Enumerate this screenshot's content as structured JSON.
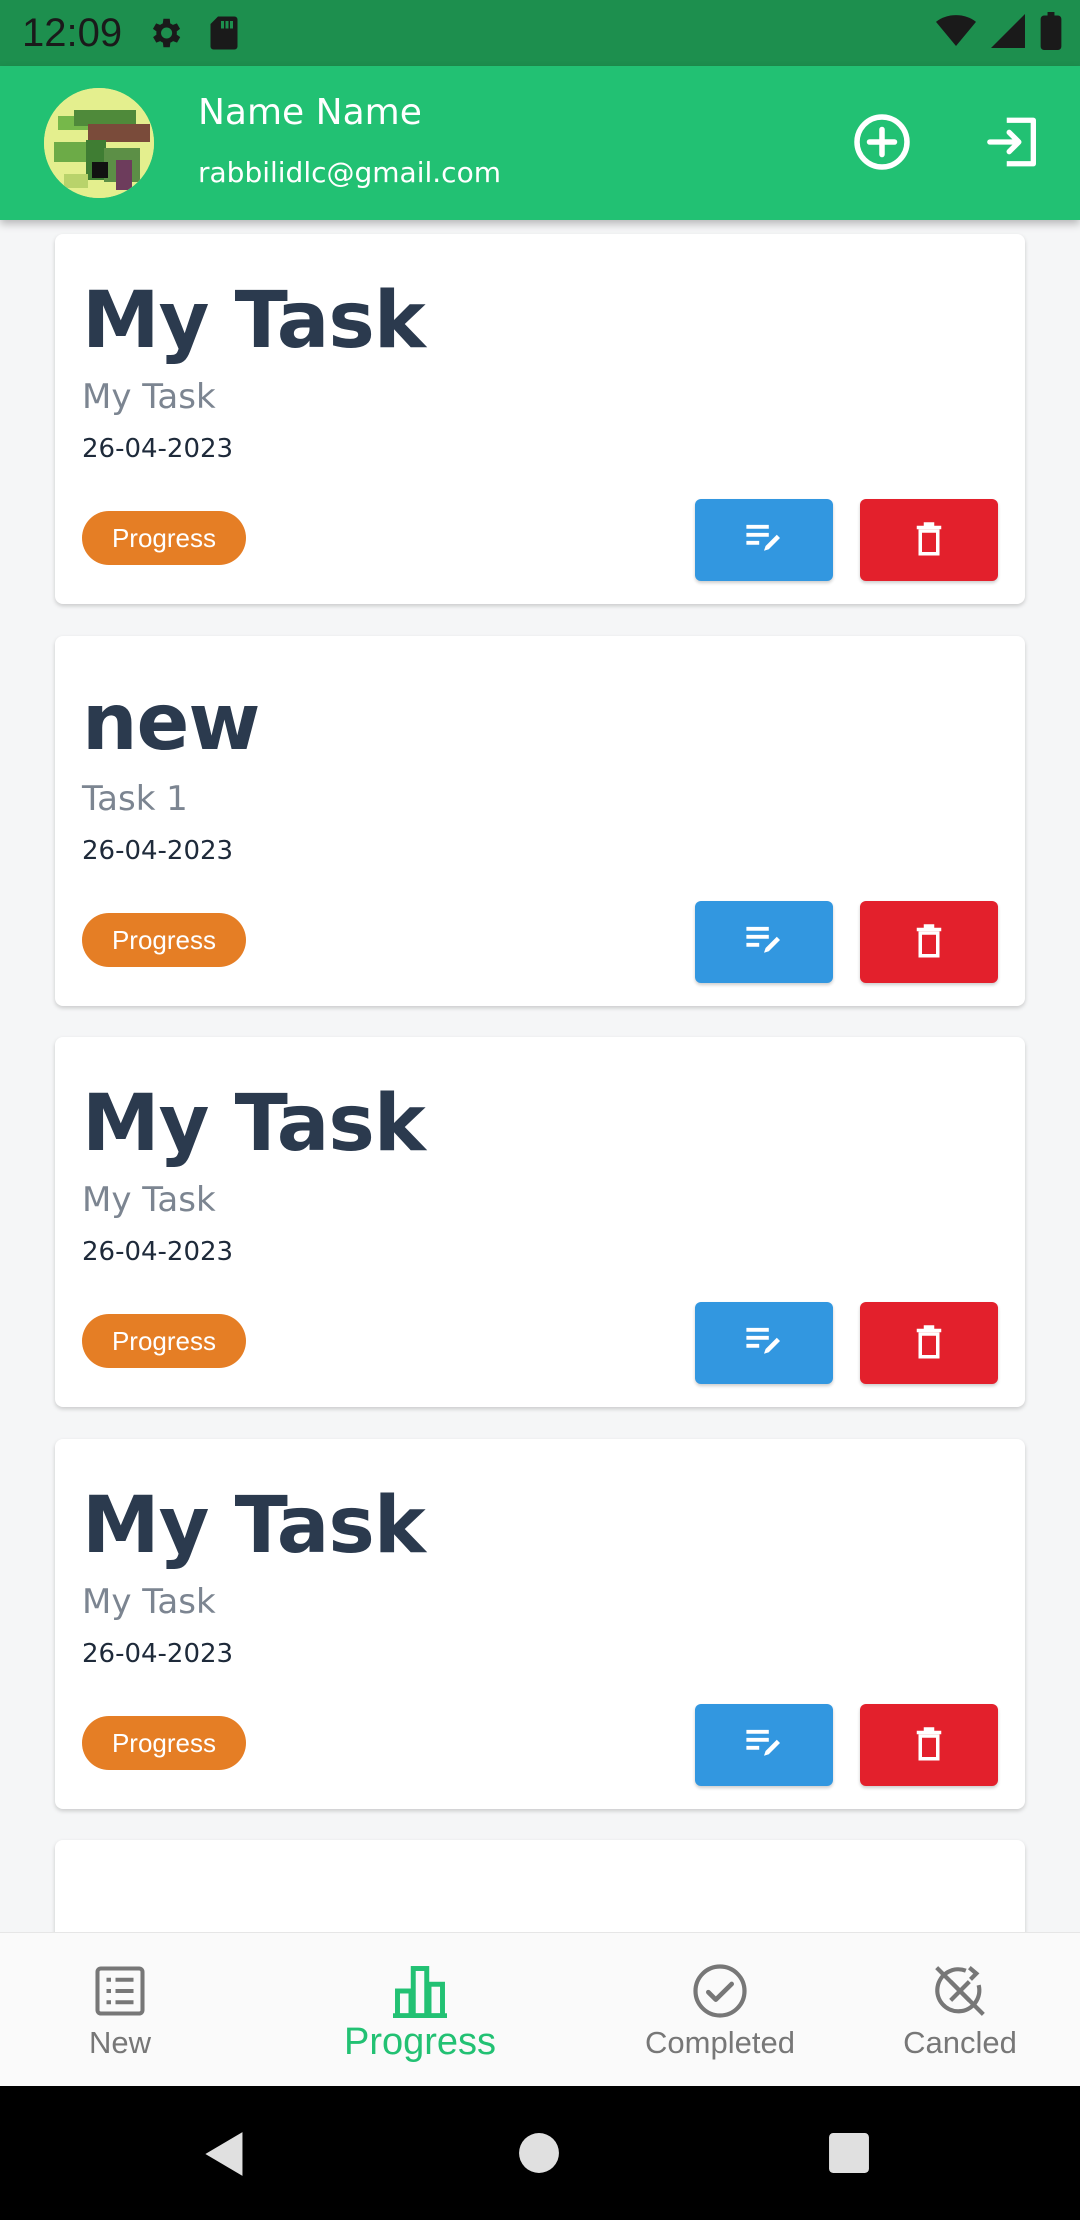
{
  "status_bar": {
    "time": "12:09"
  },
  "header": {
    "name": "Name Name",
    "email": "rabbilidlc@gmail.com"
  },
  "tasks": [
    {
      "title": "My Task",
      "description": "My Task",
      "date": "26-04-2023",
      "status": "Progress"
    },
    {
      "title": "new",
      "description": "Task 1",
      "date": "26-04-2023",
      "status": "Progress"
    },
    {
      "title": "My Task",
      "description": "My Task",
      "date": "26-04-2023",
      "status": "Progress"
    },
    {
      "title": "My Task",
      "description": "My Task",
      "date": "26-04-2023",
      "status": "Progress"
    }
  ],
  "bottom_nav": [
    {
      "label": "New",
      "icon": "list-icon"
    },
    {
      "label": "Progress",
      "icon": "bar-chart-icon"
    },
    {
      "label": "Completed",
      "icon": "check-circle-icon"
    },
    {
      "label": "Cancled",
      "icon": "cancel-icon"
    }
  ],
  "colors": {
    "status_bar": "#1d8f4e",
    "header": "#22c173",
    "status_chip": "#e57e25",
    "edit": "#3297e0",
    "delete": "#e3202c",
    "active_nav": "#22c173"
  }
}
